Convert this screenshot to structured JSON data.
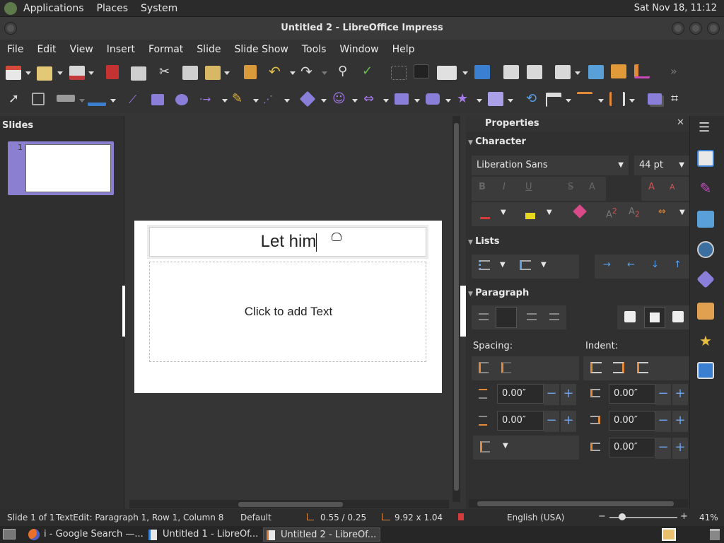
{
  "topbar": {
    "applications": "Applications",
    "places": "Places",
    "system": "System",
    "clock": "Sat Nov 18, 11:12"
  },
  "window": {
    "title": "Untitled 2 - LibreOffice Impress"
  },
  "menubar": [
    "File",
    "Edit",
    "View",
    "Insert",
    "Format",
    "Slide",
    "Slide Show",
    "Tools",
    "Window",
    "Help"
  ],
  "slides_pane": {
    "header": "Slides",
    "slide_number": "1"
  },
  "slide": {
    "title_text": "Let him",
    "body_placeholder": "Click to add Text"
  },
  "properties": {
    "header": "Properties",
    "character": {
      "label": "Character",
      "font_name": "Liberation Sans",
      "font_size": "44 pt"
    },
    "lists": {
      "label": "Lists"
    },
    "paragraph": {
      "label": "Paragraph",
      "spacing_label": "Spacing:",
      "indent_label": "Indent:",
      "spacing_above": "0.00″",
      "spacing_below": "0.00″",
      "indent_before": "0.00″",
      "indent_after": "0.00″",
      "indent_first": "0.00″"
    }
  },
  "status": {
    "slide": "Slide 1 of 1",
    "edit": "TextEdit: Paragraph 1, Row 1, Column 8",
    "layout": "Default",
    "position": "0.55 / 0.25",
    "size": "9.92 x 1.04",
    "language": "English (USA)",
    "zoom": "41%"
  },
  "taskbar": [
    {
      "label": "i - Google Search —..."
    },
    {
      "label": "Untitled 1 - LibreOf..."
    },
    {
      "label": "Untitled 2 - LibreOf..."
    }
  ],
  "colors": {
    "accent": "#8a7fd0",
    "link_blue": "#6aa0e8",
    "font_color": "#d63b3b",
    "highlight": "#e8d820"
  },
  "icons": {
    "minus": "−",
    "plus": "+",
    "close": "✕",
    "hamburger": "☰"
  }
}
